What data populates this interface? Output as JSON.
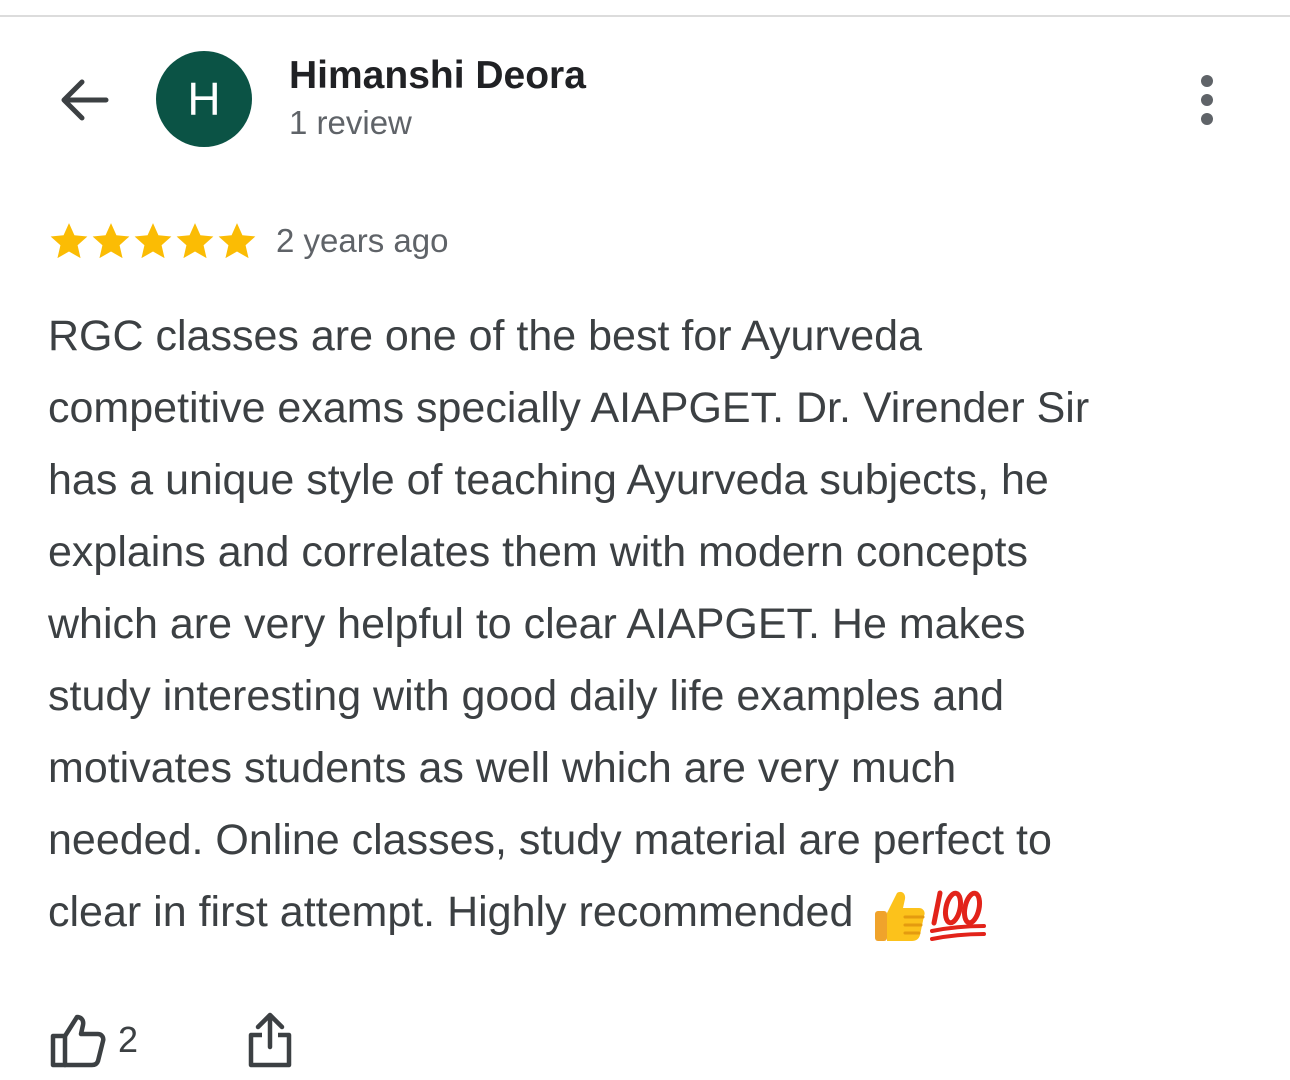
{
  "header": {
    "back_icon": "arrow-left-icon",
    "avatar_letter": "H",
    "avatar_color": "#0b5345",
    "reviewer_name": "Himanshi Deora",
    "review_count": "1 review",
    "menu_icon": "more-vert-icon"
  },
  "review": {
    "rating": 5,
    "max_rating": 5,
    "star_color": "#fbbc04",
    "date": "2 years ago",
    "lines": [
      "RGC classes are one of the best for Ayurveda",
      "competitive exams specially AIAPGET. Dr. Virender Sir",
      "has a unique style of teaching Ayurveda subjects, he",
      "explains and correlates them with modern concepts",
      "which are very helpful to clear AIAPGET. He makes",
      "study interesting with good daily life examples and",
      "motivates students as well which are very much",
      "needed. Online classes, study material are perfect to",
      "clear in first attempt. Highly recommended"
    ],
    "emojis": [
      "thumbs-up-emoji",
      "hundred-points-emoji"
    ]
  },
  "actions": {
    "like_icon": "thumbs-up-outline-icon",
    "like_count": "2",
    "share_icon": "share-icon"
  }
}
